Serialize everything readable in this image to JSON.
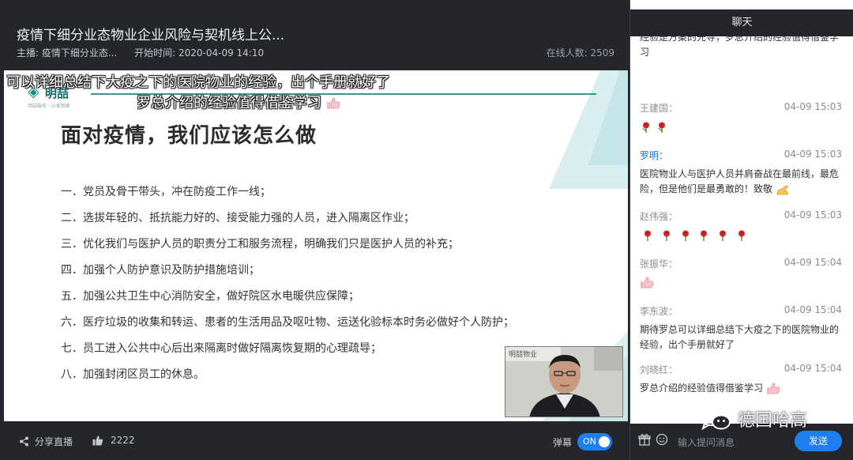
{
  "header": {
    "title": "疫情下细分业态物业企业风险与契机线上公...",
    "host": "主播: 疫情下细分业态...",
    "start_time": "开始时间: 2020-04-09 14:10",
    "online_count": "在线人数: 2509"
  },
  "slide": {
    "logo_text": "明喆",
    "logo_sub": "明喆服务 · 以爱筑家",
    "heading": "面对疫情，我们应该怎么做",
    "items": [
      "一．党员及骨干带头，冲在防疫工作一线；",
      "二．选拔年轻的、抵抗能力好的、接受能力强的人员，进入隔离区作业；",
      "三．优化我们与医护人员的职责分工和服务流程，明确我们只是医护人员的补充；",
      "四．加强个人防护意识及防护措施培训；",
      "五．加强公共卫生中心消防安全，做好院区水电暖供应保障；",
      "六．医疗垃圾的收集和转运、患者的生活用品及呕吐物、运送化验标本时务必做好个人防护；",
      "七．员工进入公共中心后出来隔离时做好隔离恢复期的心理疏导；",
      "八．加强封闭区员工的休息。"
    ]
  },
  "danmaku": {
    "line1": "可以详细总结下大疫之下的医院物业的经验，出个手册就好了",
    "line2": "罗总介绍的经验值得借鉴学习"
  },
  "pip": {
    "sign": "明喆物业"
  },
  "bottom_bar": {
    "share": "分享直播",
    "likes": "2222",
    "danmu_label": "弹幕",
    "toggle": "ON"
  },
  "chat": {
    "title": "聊天",
    "messages": [
      {
        "name": "",
        "time": "",
        "text": "经验是方案的先导，罗总介绍的经验值得借鉴学习"
      },
      {
        "name": "王建国：",
        "time": "04-09 15:03",
        "text": ""
      },
      {
        "name": "罗明：",
        "time": "04-09 15:03",
        "text": "医院物业人与医护人员并肩奋战在最前线，最危险，但是他们是最勇敢的！致敬"
      },
      {
        "name": "赵伟强：",
        "time": "04-09 15:03",
        "text": ""
      },
      {
        "name": "张振华：",
        "time": "04-09 15:04",
        "text": ""
      },
      {
        "name": "李东波：",
        "time": "04-09 15:04",
        "text": "期待罗总可以详细总结下大疫之下的医院物业的经验，出个手册就好了"
      },
      {
        "name": "刘晓红：",
        "time": "04-09 15:04",
        "text": "罗总介绍的经验值得借鉴学习"
      }
    ],
    "input_placeholder": "输入提问消息",
    "send": "发送"
  },
  "watermark": "德国哈高",
  "colors": {
    "accent": "#1f7ef2",
    "teal": "#1f7f86",
    "highlight_name": "#1d6fd6"
  }
}
